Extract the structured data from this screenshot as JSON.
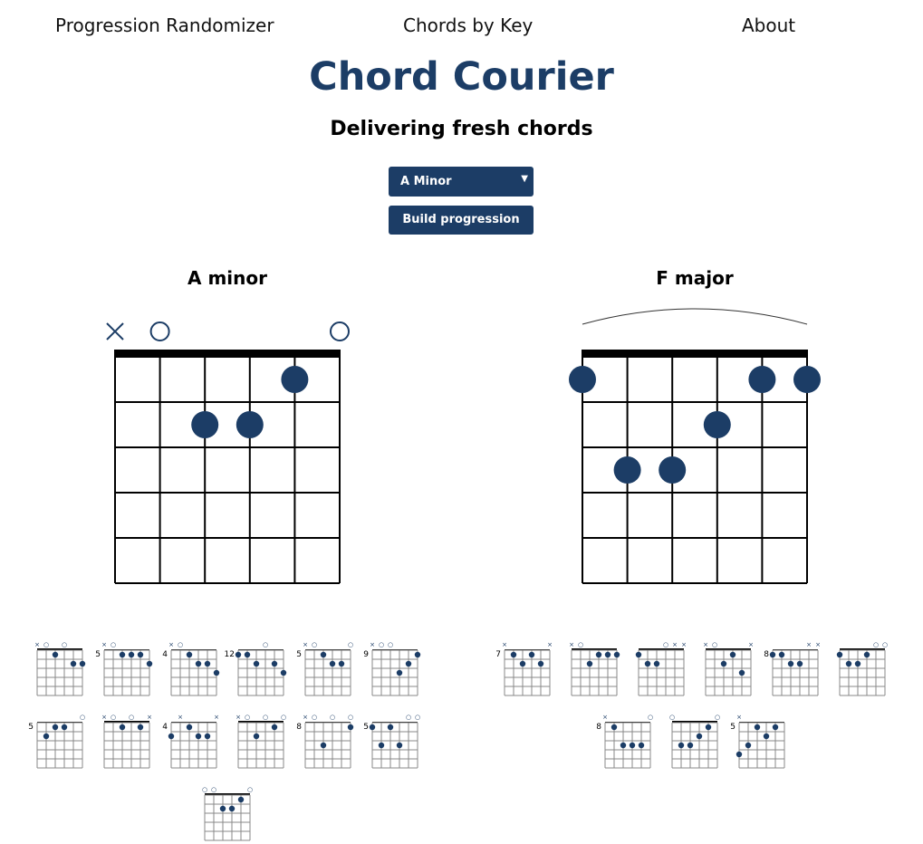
{
  "nav": {
    "randomizer": "Progression Randomizer",
    "by_key": "Chords by Key",
    "about": "About"
  },
  "header": {
    "title": "Chord Courier",
    "tagline": "Delivering fresh chords"
  },
  "controls": {
    "key_select_value": "A Minor",
    "build_label": "Build progression"
  },
  "colors": {
    "accent": "#1c3d66"
  },
  "chords": [
    {
      "name": "A minor",
      "strings": [
        "x",
        "o",
        "",
        "",
        "",
        "o"
      ],
      "dots": [
        [
          5,
          1
        ],
        [
          3,
          2
        ],
        [
          4,
          2
        ]
      ],
      "barre": false,
      "variations": [
        {
          "fret": "",
          "strings": [
            "x",
            "o",
            "",
            "o",
            "",
            ""
          ],
          "dots": [
            [
              3,
              1
            ],
            [
              5,
              2
            ],
            [
              6,
              2
            ]
          ]
        },
        {
          "fret": "5",
          "strings": [
            "x",
            "o",
            "",
            "",
            "",
            ""
          ],
          "dots": [
            [
              3,
              1
            ],
            [
              4,
              1
            ],
            [
              5,
              1
            ],
            [
              6,
              2
            ]
          ]
        },
        {
          "fret": "4",
          "strings": [
            "x",
            "o",
            "",
            "",
            "",
            ""
          ],
          "dots": [
            [
              3,
              1
            ],
            [
              4,
              2
            ],
            [
              5,
              2
            ],
            [
              6,
              3
            ]
          ]
        },
        {
          "fret": "12",
          "strings": [
            "",
            "",
            "",
            "o",
            "",
            ""
          ],
          "dots": [
            [
              1,
              1
            ],
            [
              2,
              1
            ],
            [
              3,
              2
            ],
            [
              5,
              2
            ],
            [
              6,
              3
            ]
          ]
        },
        {
          "fret": "5",
          "strings": [
            "x",
            "o",
            "",
            "",
            "",
            "o"
          ],
          "dots": [
            [
              3,
              1
            ],
            [
              4,
              2
            ],
            [
              5,
              2
            ]
          ]
        },
        {
          "fret": "9",
          "strings": [
            "x",
            "o",
            "o",
            "",
            "",
            ""
          ],
          "dots": [
            [
              5,
              2
            ],
            [
              6,
              1
            ],
            [
              4,
              3
            ]
          ]
        },
        {
          "fret": "5",
          "strings": [
            "",
            "",
            "",
            "",
            "",
            "o"
          ],
          "dots": [
            [
              2,
              2
            ],
            [
              3,
              1
            ],
            [
              4,
              1
            ]
          ]
        },
        {
          "fret": "",
          "strings": [
            "x",
            "o",
            "",
            "o",
            "",
            "x"
          ],
          "dots": [
            [
              3,
              1
            ],
            [
              5,
              1
            ]
          ]
        },
        {
          "fret": "4",
          "strings": [
            "",
            "x",
            "",
            "",
            "",
            "x"
          ],
          "dots": [
            [
              1,
              2
            ],
            [
              3,
              1
            ],
            [
              4,
              2
            ],
            [
              5,
              2
            ]
          ]
        },
        {
          "fret": "",
          "strings": [
            "x",
            "o",
            "",
            "o",
            "",
            "o"
          ],
          "dots": [
            [
              3,
              2
            ],
            [
              5,
              1
            ]
          ]
        },
        {
          "fret": "8",
          "strings": [
            "x",
            "o",
            "",
            "o",
            "",
            "o"
          ],
          "dots": [
            [
              3,
              3
            ],
            [
              6,
              1
            ]
          ]
        },
        {
          "fret": "5",
          "strings": [
            "",
            "",
            "",
            "",
            "o",
            "o"
          ],
          "dots": [
            [
              1,
              1
            ],
            [
              2,
              3
            ],
            [
              3,
              1
            ],
            [
              4,
              3
            ]
          ]
        },
        {
          "fret": "",
          "strings": [
            "o",
            "o",
            "",
            "",
            "",
            "o"
          ],
          "dots": [
            [
              3,
              2
            ],
            [
              4,
              2
            ],
            [
              5,
              1
            ]
          ]
        }
      ]
    },
    {
      "name": "F major",
      "strings": [
        "",
        "",
        "",
        "",
        "",
        ""
      ],
      "dots": [
        [
          1,
          1
        ],
        [
          5,
          1
        ],
        [
          6,
          1
        ],
        [
          4,
          2
        ],
        [
          2,
          3
        ],
        [
          3,
          3
        ]
      ],
      "barre": true,
      "variations": [
        {
          "fret": "7",
          "strings": [
            "x",
            "",
            "",
            "",
            "",
            "x"
          ],
          "dots": [
            [
              2,
              1
            ],
            [
              3,
              2
            ],
            [
              4,
              1
            ],
            [
              5,
              2
            ]
          ]
        },
        {
          "fret": "",
          "strings": [
            "x",
            "o",
            "",
            "",
            "",
            ""
          ],
          "dots": [
            [
              3,
              2
            ],
            [
              4,
              1
            ],
            [
              5,
              1
            ],
            [
              6,
              1
            ]
          ]
        },
        {
          "fret": "",
          "strings": [
            "",
            "",
            "",
            "o",
            "x",
            "x"
          ],
          "dots": [
            [
              1,
              1
            ],
            [
              2,
              2
            ],
            [
              3,
              2
            ]
          ]
        },
        {
          "fret": "",
          "strings": [
            "x",
            "o",
            "",
            "",
            "",
            "x"
          ],
          "dots": [
            [
              3,
              2
            ],
            [
              4,
              1
            ],
            [
              5,
              3
            ]
          ]
        },
        {
          "fret": "8",
          "strings": [
            "",
            "",
            "",
            "",
            "x",
            "x"
          ],
          "dots": [
            [
              1,
              1
            ],
            [
              2,
              1
            ],
            [
              3,
              2
            ],
            [
              4,
              2
            ]
          ]
        },
        {
          "fret": "",
          "strings": [
            "",
            "",
            "",
            "",
            "o",
            "o"
          ],
          "dots": [
            [
              1,
              1
            ],
            [
              2,
              2
            ],
            [
              3,
              2
            ],
            [
              4,
              1
            ]
          ]
        },
        {
          "fret": "8",
          "strings": [
            "x",
            "",
            "",
            "",
            "",
            "o"
          ],
          "dots": [
            [
              2,
              1
            ],
            [
              3,
              3
            ],
            [
              4,
              3
            ],
            [
              5,
              3
            ]
          ]
        },
        {
          "fret": "",
          "strings": [
            "o",
            "",
            "",
            "",
            "",
            "o"
          ],
          "dots": [
            [
              2,
              3
            ],
            [
              3,
              3
            ],
            [
              4,
              2
            ],
            [
              5,
              1
            ]
          ]
        },
        {
          "fret": "5",
          "strings": [
            "x",
            "",
            "",
            "",
            "",
            ""
          ],
          "dots": [
            [
              1,
              4
            ],
            [
              2,
              3
            ],
            [
              3,
              1
            ],
            [
              4,
              2
            ],
            [
              5,
              1
            ]
          ]
        }
      ]
    }
  ]
}
